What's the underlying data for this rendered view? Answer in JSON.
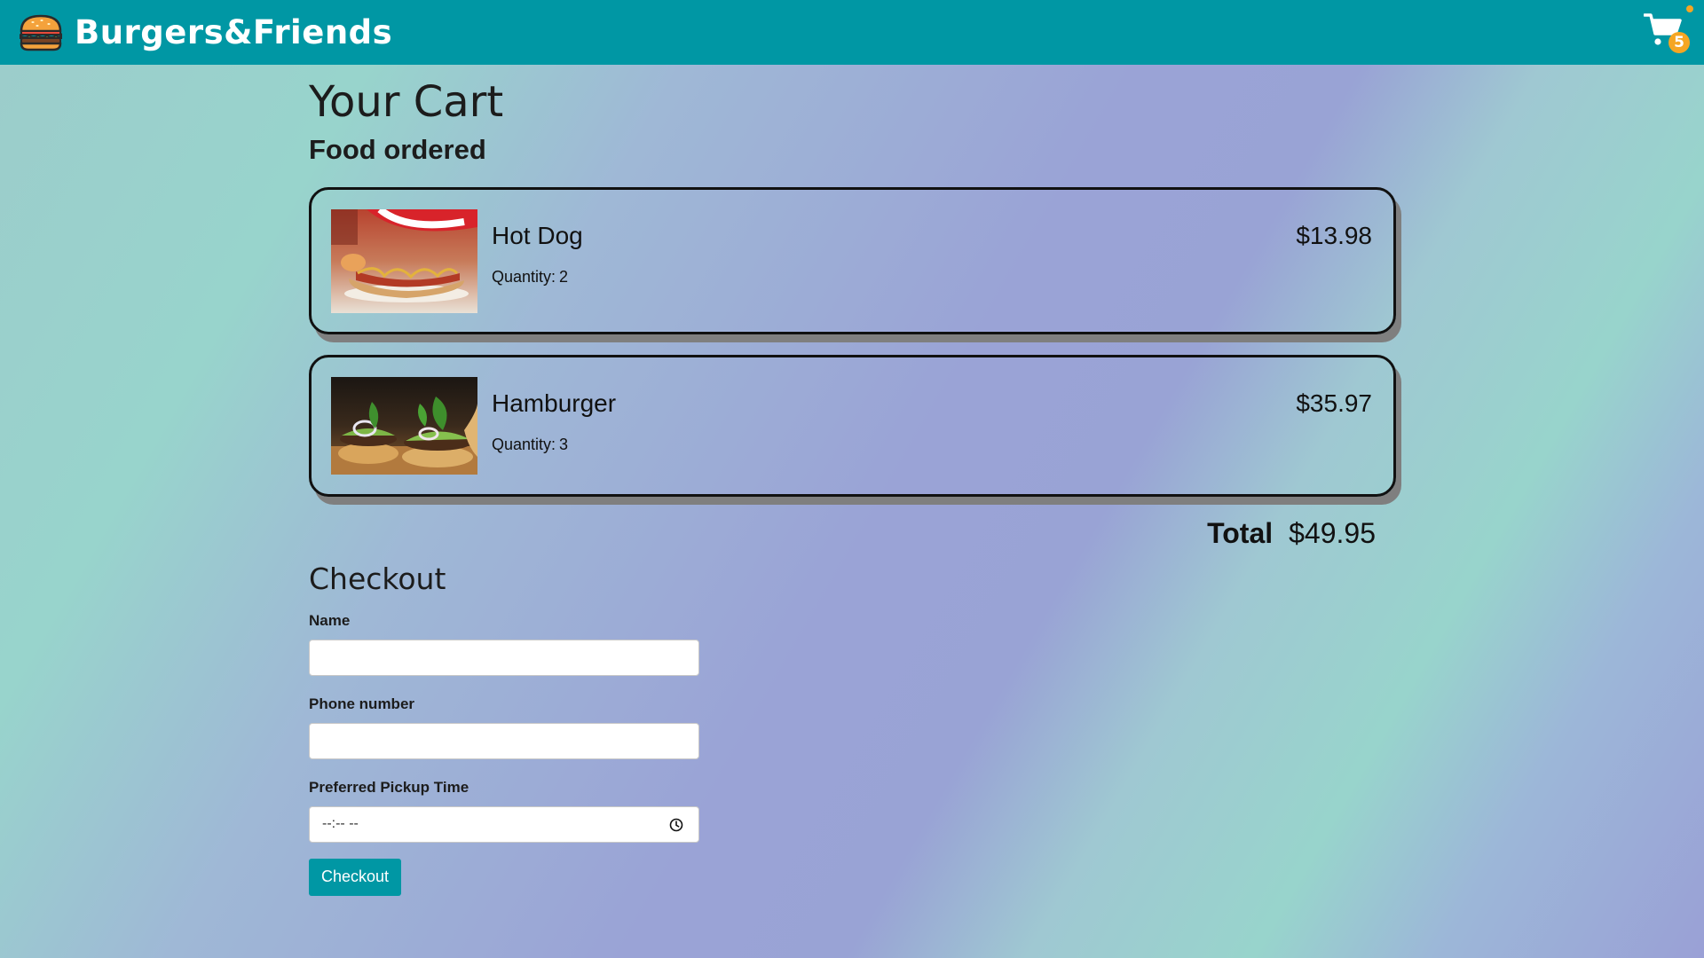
{
  "header": {
    "brand_name": "Burgers&Friends",
    "brand_icon": "burger-icon",
    "cart_icon": "cart-icon",
    "cart_count": "5",
    "accent_color": "#0097a4",
    "badge_color": "#f5a623"
  },
  "page": {
    "title": "Your Cart",
    "section_title": "Food ordered"
  },
  "cart": {
    "items": [
      {
        "name": "Hot Dog",
        "quantity_label": "Quantity:",
        "quantity": "2",
        "price": "$13.98",
        "image": "hot-dog-photo"
      },
      {
        "name": "Hamburger",
        "quantity_label": "Quantity:",
        "quantity": "3",
        "price": "$35.97",
        "image": "hamburger-photo"
      }
    ],
    "total_label": "Total",
    "total_value": "$49.95"
  },
  "checkout": {
    "title": "Checkout",
    "name_label": "Name",
    "name_value": "",
    "phone_label": "Phone number",
    "phone_value": "",
    "pickup_label": "Preferred Pickup Time",
    "pickup_value": "--:-- --",
    "button_label": "Checkout"
  }
}
